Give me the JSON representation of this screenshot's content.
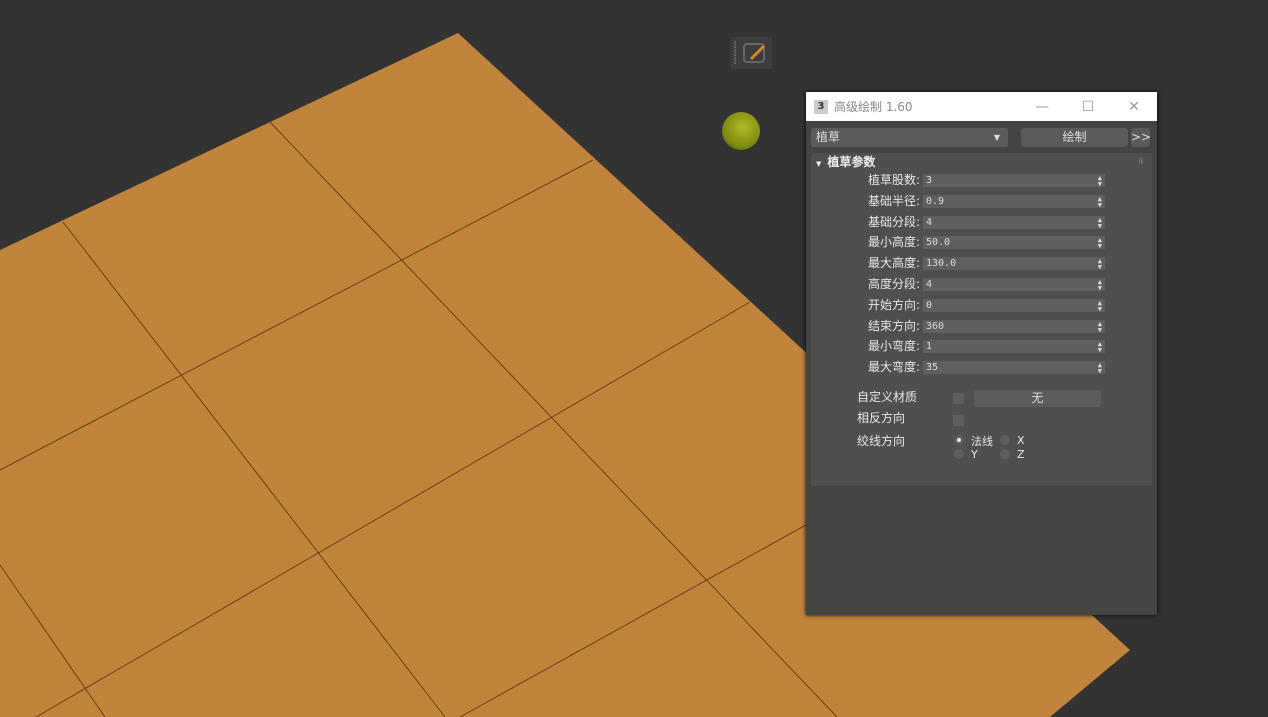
{
  "window": {
    "title": "高级绘制 1.60",
    "icon": "3"
  },
  "toolbar": {
    "type_value": "植草",
    "draw_label": "绘制",
    "expand_label": ">>"
  },
  "rollout": {
    "title": "植草参数",
    "params": [
      {
        "label": "植草股数:",
        "value": "3"
      },
      {
        "label": "基础半径:",
        "value": "0.9"
      },
      {
        "label": "基础分段:",
        "value": "4"
      },
      {
        "label": "最小高度:",
        "value": "50.0"
      },
      {
        "label": "最大高度:",
        "value": "130.0"
      },
      {
        "label": "高度分段:",
        "value": "4"
      },
      {
        "label": "开始方向:",
        "value": "0"
      },
      {
        "label": "结束方向:",
        "value": "360"
      },
      {
        "label": "最小弯度:",
        "value": "1"
      },
      {
        "label": "最大弯度:",
        "value": "35"
      }
    ],
    "custom_material_label": "自定义材质",
    "material_button": "无",
    "reverse_label": "相反方向",
    "twist_label": "绞线方向",
    "radios": [
      "法线",
      "X",
      "Y",
      "Z"
    ]
  },
  "colors": {
    "plane": "#c0843c",
    "background": "#333333"
  }
}
